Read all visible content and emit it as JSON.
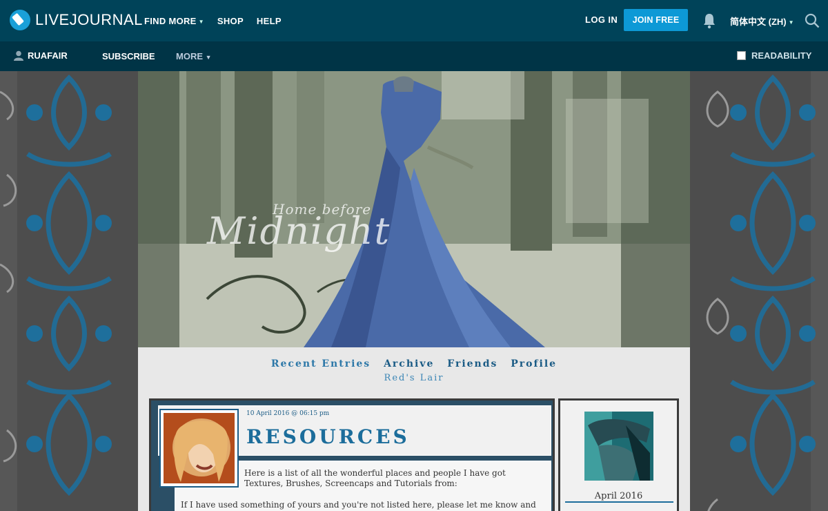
{
  "brand": {
    "logo_text": "LIVEJOURNAL",
    "accent": "#0d99d6"
  },
  "topnav": {
    "items": [
      {
        "label": "FIND MORE",
        "has_dropdown": true
      },
      {
        "label": "SHOP",
        "has_dropdown": false
      },
      {
        "label": "HELP",
        "has_dropdown": false
      }
    ],
    "login_label": "LOG IN",
    "join_label": "JOIN FREE",
    "language_label": "简体中文 (ZH)"
  },
  "subnav": {
    "username": "RUAFAIR",
    "subscribe_label": "SUBSCRIBE",
    "more_label": "MORE",
    "readability_label": "READABILITY"
  },
  "banner": {
    "title_small": "Home before",
    "title_large": "Midnight"
  },
  "journal_nav": {
    "links": [
      "Recent Entries",
      "Archive",
      "Friends",
      "Profile"
    ],
    "subtitle": "Red's Lair"
  },
  "entry": {
    "date": "10 April 2016 @ 06:15 pm",
    "title": "RESOURCES",
    "body_p1": "Here is a list of all the wonderful places and people I have got Textures, Brushes, Screencaps and Tutorials from:",
    "body_p2": "If I have used something of yours and you're not listed here, please let me know and I'll add you."
  },
  "sidebar": {
    "calendar_month": "April 2016"
  },
  "icons": [
    "user-icon",
    "bell-icon",
    "search-icon",
    "chevron-down-icon"
  ]
}
